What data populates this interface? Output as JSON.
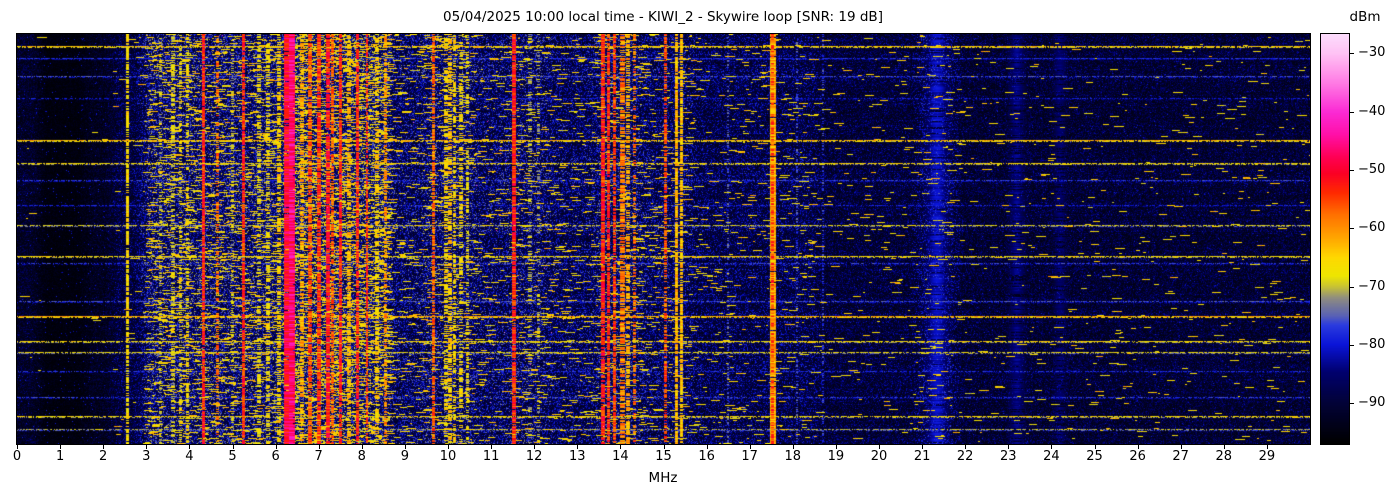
{
  "figure": {
    "title": "05/04/2025 10:00 local time - KIWI_2 - Skywire loop [SNR: 19 dB]",
    "xlabel": "MHz",
    "colorbar_label": "dBm"
  },
  "chart_data": {
    "type": "heatmap",
    "title": "05/04/2025 10:00 local time - KIWI_2 - Skywire loop [SNR: 19 dB]",
    "xlabel": "MHz",
    "ylabel": "",
    "x_range": [
      0,
      30
    ],
    "x_ticks": [
      0,
      1,
      2,
      3,
      4,
      5,
      6,
      7,
      8,
      9,
      10,
      11,
      12,
      13,
      14,
      15,
      16,
      17,
      18,
      19,
      20,
      21,
      22,
      23,
      24,
      25,
      26,
      27,
      28,
      29
    ],
    "grid": false,
    "legend": "none",
    "colorbar": {
      "label": "dBm",
      "tick_values": [
        -30,
        -40,
        -50,
        -60,
        -70,
        -80,
        -90
      ],
      "tick_labels": [
        "−30",
        "−40",
        "−50",
        "−60",
        "−70",
        "−80",
        "−90"
      ],
      "vmin": -97.0,
      "vmax": -26.7,
      "position": "right"
    },
    "colormap_stops": [
      [
        0.0,
        "#000000"
      ],
      [
        0.1,
        "#020238"
      ],
      [
        0.175,
        "#00006e"
      ],
      [
        0.242,
        "#0a14d8"
      ],
      [
        0.29,
        "#2b3cde"
      ],
      [
        0.313,
        "#5a62b4"
      ],
      [
        0.356,
        "#8f8d80"
      ],
      [
        0.384,
        "#c9c332"
      ],
      [
        0.41,
        "#eee600"
      ],
      [
        0.455,
        "#ffd800"
      ],
      [
        0.5,
        "#ffa800"
      ],
      [
        0.56,
        "#ff7000"
      ],
      [
        0.612,
        "#ff2a00"
      ],
      [
        0.66,
        "#fb0025"
      ],
      [
        0.7,
        "#ff0054"
      ],
      [
        0.755,
        "#ff10a8"
      ],
      [
        0.81,
        "#fb2ad4"
      ],
      [
        0.88,
        "#ff7ae4"
      ],
      [
        0.953,
        "#ffc2f4"
      ],
      [
        1.0,
        "#fcdcfc"
      ]
    ],
    "noise_floor_bands": [
      {
        "f0": 0.0,
        "f1": 0.5,
        "floor_dbm": -88,
        "yellow_speckle": 0.002
      },
      {
        "f0": 0.5,
        "f1": 1.6,
        "floor_dbm": -94,
        "yellow_speckle": 0.0
      },
      {
        "f0": 1.6,
        "f1": 2.2,
        "floor_dbm": -90,
        "yellow_speckle": 0.001
      },
      {
        "f0": 2.2,
        "f1": 2.9,
        "floor_dbm": -84,
        "yellow_speckle": 0.004
      },
      {
        "f0": 2.9,
        "f1": 4.4,
        "floor_dbm": -76,
        "yellow_speckle": 0.05
      },
      {
        "f0": 4.4,
        "f1": 6.2,
        "floor_dbm": -76,
        "yellow_speckle": 0.05
      },
      {
        "f0": 6.2,
        "f1": 8.6,
        "floor_dbm": -74,
        "yellow_speckle": 0.12
      },
      {
        "f0": 8.6,
        "f1": 9.4,
        "floor_dbm": -79,
        "yellow_speckle": 0.02
      },
      {
        "f0": 9.4,
        "f1": 10.6,
        "floor_dbm": -77,
        "yellow_speckle": 0.04
      },
      {
        "f0": 10.6,
        "f1": 11.4,
        "floor_dbm": -79,
        "yellow_speckle": 0.02
      },
      {
        "f0": 11.4,
        "f1": 12.3,
        "floor_dbm": -78,
        "yellow_speckle": 0.03
      },
      {
        "f0": 12.3,
        "f1": 13.4,
        "floor_dbm": -80,
        "yellow_speckle": 0.02
      },
      {
        "f0": 13.4,
        "f1": 14.5,
        "floor_dbm": -78,
        "yellow_speckle": 0.035
      },
      {
        "f0": 14.5,
        "f1": 15.7,
        "floor_dbm": -80,
        "yellow_speckle": 0.025
      },
      {
        "f0": 15.7,
        "f1": 18.6,
        "floor_dbm": -82,
        "yellow_speckle": 0.012
      },
      {
        "f0": 18.6,
        "f1": 20.9,
        "floor_dbm": -85,
        "yellow_speckle": 0.006
      },
      {
        "f0": 20.9,
        "f1": 21.8,
        "floor_dbm": -81,
        "yellow_speckle": 0.01
      },
      {
        "f0": 21.8,
        "f1": 30.0,
        "floor_dbm": -86,
        "yellow_speckle": 0.005
      }
    ],
    "signals": [
      {
        "f": 2.57,
        "w": 0.02,
        "dbm": -66,
        "persist": 0.75
      },
      {
        "f": 3.33,
        "w": 0.02,
        "dbm": -70,
        "persist": 0.35
      },
      {
        "f": 3.62,
        "w": 0.04,
        "dbm": -69,
        "persist": 0.4
      },
      {
        "f": 3.8,
        "w": 0.025,
        "dbm": -68,
        "persist": 0.4
      },
      {
        "f": 3.95,
        "w": 0.025,
        "dbm": -67,
        "persist": 0.45
      },
      {
        "f": 4.33,
        "w": 0.025,
        "dbm": -53,
        "persist": 0.93
      },
      {
        "f": 4.65,
        "w": 0.02,
        "dbm": -58,
        "persist": 0.5
      },
      {
        "f": 5.0,
        "w": 0.02,
        "dbm": -70,
        "persist": 0.3
      },
      {
        "f": 5.26,
        "w": 0.025,
        "dbm": -53,
        "persist": 0.9
      },
      {
        "f": 5.62,
        "w": 0.03,
        "dbm": -68,
        "persist": 0.4
      },
      {
        "f": 5.82,
        "w": 0.03,
        "dbm": -67,
        "persist": 0.45
      },
      {
        "f": 6.07,
        "w": 0.03,
        "dbm": -65,
        "persist": 0.5
      },
      {
        "f": 6.3,
        "w": 0.09,
        "dbm": -50,
        "persist": 0.97
      },
      {
        "f": 6.38,
        "w": 0.05,
        "dbm": -47,
        "persist": 0.97
      },
      {
        "f": 6.62,
        "w": 0.03,
        "dbm": -62,
        "persist": 0.6
      },
      {
        "f": 6.8,
        "w": 0.03,
        "dbm": -56,
        "persist": 0.8
      },
      {
        "f": 7.0,
        "w": 0.035,
        "dbm": -54,
        "persist": 0.85
      },
      {
        "f": 7.21,
        "w": 0.03,
        "dbm": -52,
        "persist": 0.9
      },
      {
        "f": 7.32,
        "w": 0.03,
        "dbm": -57,
        "persist": 0.7
      },
      {
        "f": 7.5,
        "w": 0.025,
        "dbm": -53,
        "persist": 0.85
      },
      {
        "f": 7.7,
        "w": 0.03,
        "dbm": -63,
        "persist": 0.6
      },
      {
        "f": 7.9,
        "w": 0.03,
        "dbm": -53,
        "persist": 0.85
      },
      {
        "f": 8.12,
        "w": 0.02,
        "dbm": -54,
        "persist": 0.8
      },
      {
        "f": 8.35,
        "w": 0.03,
        "dbm": -65,
        "persist": 0.55
      },
      {
        "f": 8.55,
        "w": 0.02,
        "dbm": -60,
        "persist": 0.6
      },
      {
        "f": 9.67,
        "w": 0.02,
        "dbm": -57,
        "persist": 0.75
      },
      {
        "f": 9.95,
        "w": 0.03,
        "dbm": -66,
        "persist": 0.5
      },
      {
        "f": 10.05,
        "w": 0.03,
        "dbm": -64,
        "persist": 0.55
      },
      {
        "f": 10.15,
        "w": 0.03,
        "dbm": -66,
        "persist": 0.5
      },
      {
        "f": 10.3,
        "w": 0.03,
        "dbm": -67,
        "persist": 0.45
      },
      {
        "f": 10.45,
        "w": 0.02,
        "dbm": -68,
        "persist": 0.4
      },
      {
        "f": 11.53,
        "w": 0.025,
        "dbm": -53,
        "persist": 0.92
      },
      {
        "f": 11.9,
        "w": 0.03,
        "dbm": -71,
        "persist": 0.3
      },
      {
        "f": 12.1,
        "w": 0.03,
        "dbm": -70,
        "persist": 0.3
      },
      {
        "f": 13.6,
        "w": 0.025,
        "dbm": -53,
        "persist": 0.9
      },
      {
        "f": 13.72,
        "w": 0.02,
        "dbm": -54,
        "persist": 0.85
      },
      {
        "f": 13.87,
        "w": 0.02,
        "dbm": -55,
        "persist": 0.8
      },
      {
        "f": 14.05,
        "w": 0.04,
        "dbm": -59,
        "persist": 0.7
      },
      {
        "f": 14.17,
        "w": 0.03,
        "dbm": -62,
        "persist": 0.55
      },
      {
        "f": 14.32,
        "w": 0.02,
        "dbm": -58,
        "persist": 0.5
      },
      {
        "f": 15.05,
        "w": 0.018,
        "dbm": -56,
        "persist": 0.65
      },
      {
        "f": 15.3,
        "w": 0.03,
        "dbm": -63,
        "persist": 0.85
      },
      {
        "f": 15.42,
        "w": 0.025,
        "dbm": -64,
        "persist": 0.8
      },
      {
        "f": 16.5,
        "w": 0.015,
        "dbm": -75,
        "persist": 0.35
      },
      {
        "f": 17.55,
        "w": 0.055,
        "dbm": -62,
        "persist": 0.95
      },
      {
        "f": 17.53,
        "w": 0.02,
        "dbm": -55,
        "persist": 0.6
      },
      {
        "f": 18.1,
        "w": 0.015,
        "dbm": -76,
        "persist": 0.4
      },
      {
        "f": 18.7,
        "w": 0.015,
        "dbm": -77,
        "persist": 0.35
      },
      {
        "f": 21.35,
        "w": 0.35,
        "dbm": -81,
        "persist": 0.9
      },
      {
        "f": 23.2,
        "w": 0.25,
        "dbm": -84,
        "persist": 0.8
      },
      {
        "f": 24.2,
        "w": 0.2,
        "dbm": -85,
        "persist": 0.7
      }
    ],
    "broadband_streaks": [
      {
        "y": 0.029,
        "dbm": -64,
        "coverage": 0.9
      },
      {
        "y": 0.059,
        "dbm": -78,
        "coverage": 0.8
      },
      {
        "y": 0.103,
        "dbm": -76,
        "coverage": 0.7
      },
      {
        "y": 0.157,
        "dbm": -79,
        "coverage": 0.6
      },
      {
        "y": 0.26,
        "dbm": -63,
        "coverage": 0.92
      },
      {
        "y": 0.316,
        "dbm": -66,
        "coverage": 0.85
      },
      {
        "y": 0.358,
        "dbm": -77,
        "coverage": 0.7
      },
      {
        "y": 0.419,
        "dbm": -79,
        "coverage": 0.6
      },
      {
        "y": 0.468,
        "dbm": -69,
        "coverage": 0.8
      },
      {
        "y": 0.542,
        "dbm": -66,
        "coverage": 0.85
      },
      {
        "y": 0.561,
        "dbm": -77,
        "coverage": 0.6
      },
      {
        "y": 0.652,
        "dbm": -76,
        "coverage": 0.7
      },
      {
        "y": 0.689,
        "dbm": -62,
        "coverage": 0.95
      },
      {
        "y": 0.75,
        "dbm": -66,
        "coverage": 0.85
      },
      {
        "y": 0.777,
        "dbm": -68,
        "coverage": 0.8
      },
      {
        "y": 0.824,
        "dbm": -78,
        "coverage": 0.6
      },
      {
        "y": 0.887,
        "dbm": -77,
        "coverage": 0.65
      },
      {
        "y": 0.934,
        "dbm": -66,
        "coverage": 0.8
      },
      {
        "y": 0.966,
        "dbm": -71,
        "coverage": 0.7
      }
    ]
  }
}
